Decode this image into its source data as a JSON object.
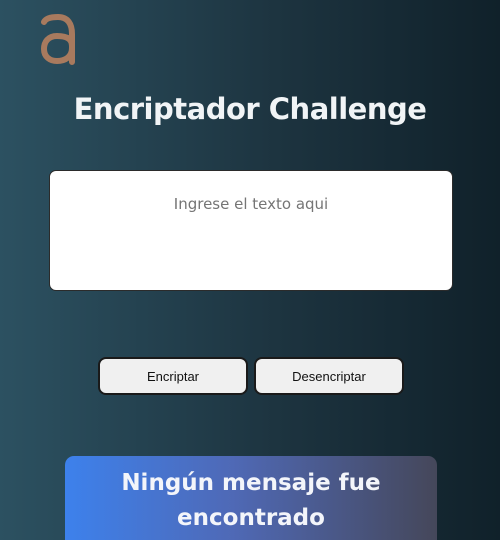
{
  "app": {
    "logo_icon": "alura-a-logo-icon",
    "logo_color": "#a87a5e",
    "title": "Encriptador Challenge"
  },
  "input": {
    "value": "",
    "placeholder": "Ingrese el texto aqui"
  },
  "buttons": {
    "encrypt_label": "Encriptar",
    "decrypt_label": "Desencriptar"
  },
  "output": {
    "message": "Ningún mensaje fue encontrado"
  },
  "colors": {
    "background_start": "#2c5161",
    "background_end": "#10212a",
    "card_gradient_start": "#3d81ec",
    "card_gradient_end": "#45475a"
  }
}
